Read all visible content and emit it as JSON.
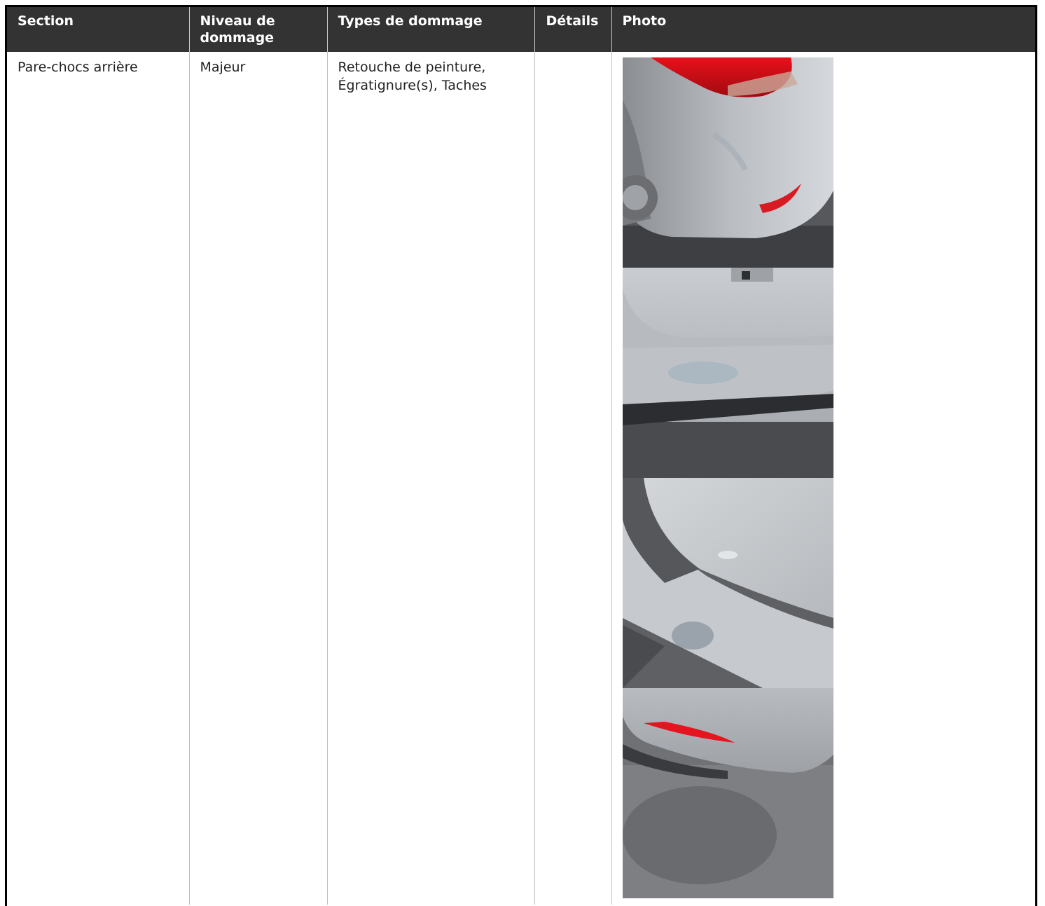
{
  "table": {
    "headers": {
      "section": "Section",
      "niveau": "Niveau de dommage",
      "types": "Types de dommage",
      "details": "Détails",
      "photo": "Photo"
    },
    "rows": [
      {
        "section": "Pare-chocs arrière",
        "niveau": "Majeur",
        "types": "Retouche de peinture, Égratignure(s), Taches",
        "details": "",
        "photos": [
          "rear-bumper-taillight-photo",
          "rear-bumper-paint-touchup-photo",
          "rear-bumper-corner-scratch-photo",
          "rear-bumper-reflector-photo"
        ]
      }
    ]
  },
  "colors": {
    "header_bg": "#333333",
    "header_text": "#ffffff",
    "border": "#000000"
  }
}
